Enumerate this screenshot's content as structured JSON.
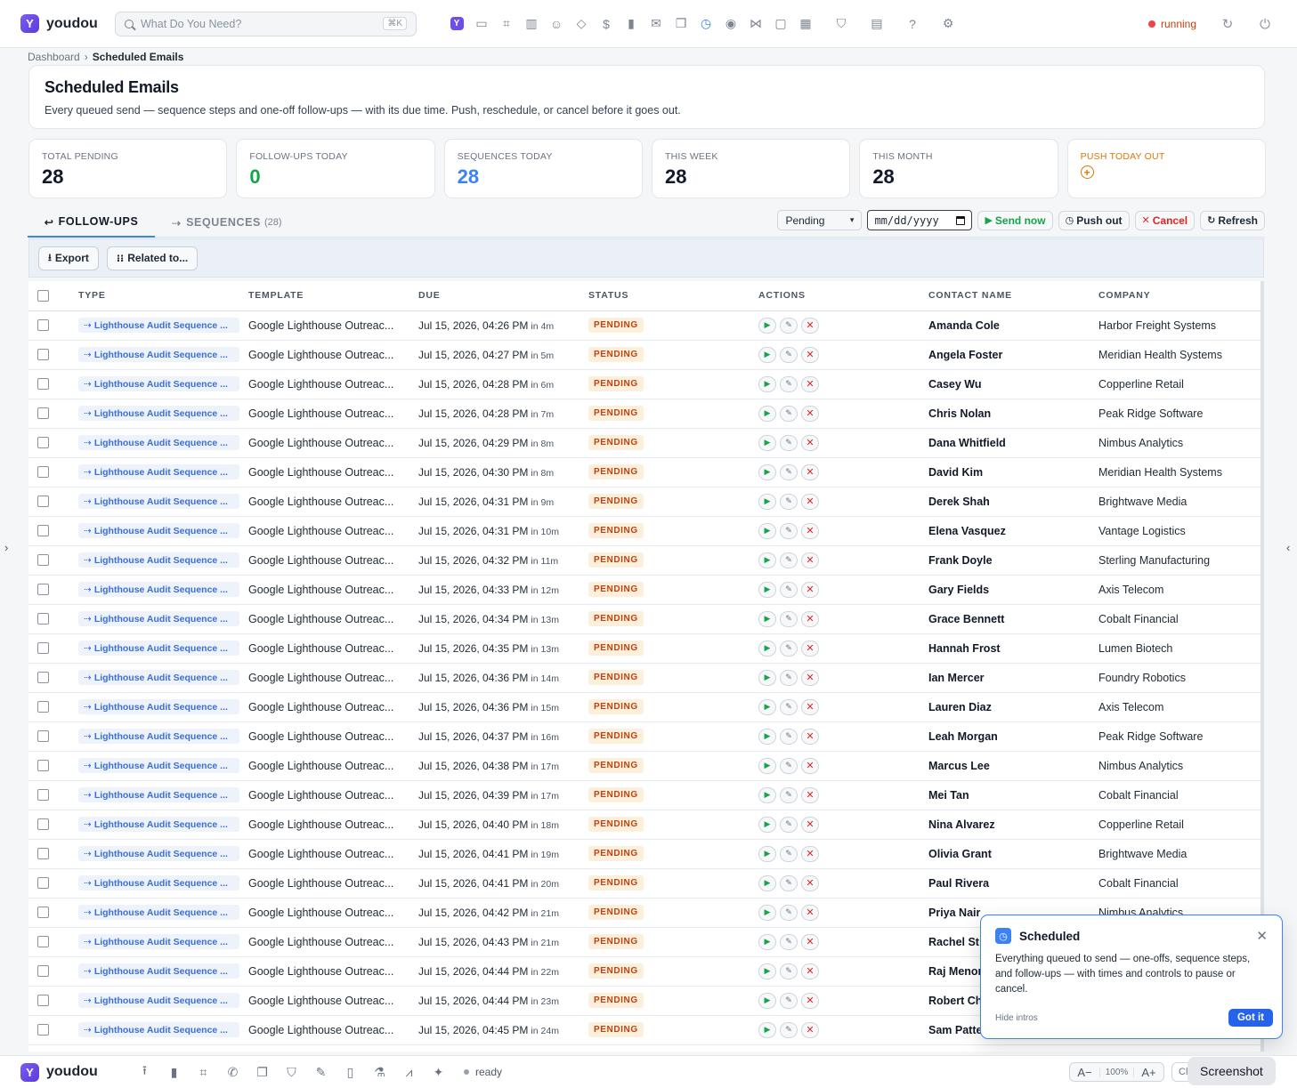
{
  "app": {
    "name": "youdou",
    "logo_letter": "Y"
  },
  "search": {
    "placeholder": "What Do You Need?",
    "shortcut": "⌘K"
  },
  "topnav": {
    "icons": [
      "ybadge-icon",
      "inbox-icon",
      "apps-grid-icon",
      "building-icon",
      "users-icon",
      "diamond-icon",
      "dollar-icon",
      "bar-chart-icon",
      "mail-icon",
      "copy-icon",
      "clock-icon",
      "eye-icon",
      "share-icon",
      "chat-icon",
      "calendar-icon",
      "shield-icon",
      "clipboard-icon",
      "help-icon",
      "gear-icon"
    ],
    "active": "clock-icon",
    "status": "running"
  },
  "breadcrumb": {
    "root": "Dashboard",
    "sep": "›",
    "current": "Scheduled Emails"
  },
  "header": {
    "title": "Scheduled Emails",
    "subtitle": "Every queued send — sequence steps and one-off follow-ups — with its due time. Push, reschedule, or cancel before it goes out."
  },
  "stats": {
    "total_pending": {
      "label": "TOTAL PENDING",
      "value": "28"
    },
    "followups_today": {
      "label": "FOLLOW-UPS TODAY",
      "value": "0"
    },
    "sequences_today": {
      "label": "SEQUENCES TODAY",
      "value": "28"
    },
    "this_week": {
      "label": "THIS WEEK",
      "value": "28"
    },
    "this_month": {
      "label": "THIS MONTH",
      "value": "28"
    },
    "push_today": {
      "label": "PUSH TODAY OUT"
    }
  },
  "tabs": {
    "followups": {
      "icon": "↩",
      "label": "FOLLOW-UPS"
    },
    "sequences": {
      "icon": "⇢",
      "label": "SEQUENCES",
      "count": "(28)"
    }
  },
  "controls": {
    "status_filter": "Pending",
    "date_placeholder": "mm/dd/yyyy",
    "send_now": "Send now",
    "push_out": "Push out",
    "cancel": "Cancel",
    "refresh": "Refresh"
  },
  "toolbar": {
    "export": "Export",
    "related": "Related to..."
  },
  "table": {
    "headers": {
      "type": "TYPE",
      "template": "TEMPLATE",
      "due": "DUE",
      "status": "STATUS",
      "actions": "ACTIONS",
      "contact": "CONTACT NAME",
      "company": "COMPANY"
    },
    "rows": [
      {
        "type": "Lighthouse Audit Sequence ...",
        "template": "Google Lighthouse Outreac...",
        "due": "Jul 15, 2026, 04:26 PM",
        "rel": "in 4m",
        "status": "PENDING",
        "contact": "Amanda Cole",
        "company": "Harbor Freight Systems"
      },
      {
        "type": "Lighthouse Audit Sequence ...",
        "template": "Google Lighthouse Outreac...",
        "due": "Jul 15, 2026, 04:27 PM",
        "rel": "in 5m",
        "status": "PENDING",
        "contact": "Angela Foster",
        "company": "Meridian Health Systems"
      },
      {
        "type": "Lighthouse Audit Sequence ...",
        "template": "Google Lighthouse Outreac...",
        "due": "Jul 15, 2026, 04:28 PM",
        "rel": "in 6m",
        "status": "PENDING",
        "contact": "Casey Wu",
        "company": "Copperline Retail"
      },
      {
        "type": "Lighthouse Audit Sequence ...",
        "template": "Google Lighthouse Outreac...",
        "due": "Jul 15, 2026, 04:28 PM",
        "rel": "in 7m",
        "status": "PENDING",
        "contact": "Chris Nolan",
        "company": "Peak Ridge Software"
      },
      {
        "type": "Lighthouse Audit Sequence ...",
        "template": "Google Lighthouse Outreac...",
        "due": "Jul 15, 2026, 04:29 PM",
        "rel": "in 8m",
        "status": "PENDING",
        "contact": "Dana Whitfield",
        "company": "Nimbus Analytics"
      },
      {
        "type": "Lighthouse Audit Sequence ...",
        "template": "Google Lighthouse Outreac...",
        "due": "Jul 15, 2026, 04:30 PM",
        "rel": "in 8m",
        "status": "PENDING",
        "contact": "David Kim",
        "company": "Meridian Health Systems"
      },
      {
        "type": "Lighthouse Audit Sequence ...",
        "template": "Google Lighthouse Outreac...",
        "due": "Jul 15, 2026, 04:31 PM",
        "rel": "in 9m",
        "status": "PENDING",
        "contact": "Derek Shah",
        "company": "Brightwave Media"
      },
      {
        "type": "Lighthouse Audit Sequence ...",
        "template": "Google Lighthouse Outreac...",
        "due": "Jul 15, 2026, 04:31 PM",
        "rel": "in 10m",
        "status": "PENDING",
        "contact": "Elena Vasquez",
        "company": "Vantage Logistics"
      },
      {
        "type": "Lighthouse Audit Sequence ...",
        "template": "Google Lighthouse Outreac...",
        "due": "Jul 15, 2026, 04:32 PM",
        "rel": "in 11m",
        "status": "PENDING",
        "contact": "Frank Doyle",
        "company": "Sterling Manufacturing"
      },
      {
        "type": "Lighthouse Audit Sequence ...",
        "template": "Google Lighthouse Outreac...",
        "due": "Jul 15, 2026, 04:33 PM",
        "rel": "in 12m",
        "status": "PENDING",
        "contact": "Gary Fields",
        "company": "Axis Telecom"
      },
      {
        "type": "Lighthouse Audit Sequence ...",
        "template": "Google Lighthouse Outreac...",
        "due": "Jul 15, 2026, 04:34 PM",
        "rel": "in 13m",
        "status": "PENDING",
        "contact": "Grace Bennett",
        "company": "Cobalt Financial"
      },
      {
        "type": "Lighthouse Audit Sequence ...",
        "template": "Google Lighthouse Outreac...",
        "due": "Jul 15, 2026, 04:35 PM",
        "rel": "in 13m",
        "status": "PENDING",
        "contact": "Hannah Frost",
        "company": "Lumen Biotech"
      },
      {
        "type": "Lighthouse Audit Sequence ...",
        "template": "Google Lighthouse Outreac...",
        "due": "Jul 15, 2026, 04:36 PM",
        "rel": "in 14m",
        "status": "PENDING",
        "contact": "Ian Mercer",
        "company": "Foundry Robotics"
      },
      {
        "type": "Lighthouse Audit Sequence ...",
        "template": "Google Lighthouse Outreac...",
        "due": "Jul 15, 2026, 04:36 PM",
        "rel": "in 15m",
        "status": "PENDING",
        "contact": "Lauren Diaz",
        "company": "Axis Telecom"
      },
      {
        "type": "Lighthouse Audit Sequence ...",
        "template": "Google Lighthouse Outreac...",
        "due": "Jul 15, 2026, 04:37 PM",
        "rel": "in 16m",
        "status": "PENDING",
        "contact": "Leah Morgan",
        "company": "Peak Ridge Software"
      },
      {
        "type": "Lighthouse Audit Sequence ...",
        "template": "Google Lighthouse Outreac...",
        "due": "Jul 15, 2026, 04:38 PM",
        "rel": "in 17m",
        "status": "PENDING",
        "contact": "Marcus Lee",
        "company": "Nimbus Analytics"
      },
      {
        "type": "Lighthouse Audit Sequence ...",
        "template": "Google Lighthouse Outreac...",
        "due": "Jul 15, 2026, 04:39 PM",
        "rel": "in 17m",
        "status": "PENDING",
        "contact": "Mei Tan",
        "company": "Cobalt Financial"
      },
      {
        "type": "Lighthouse Audit Sequence ...",
        "template": "Google Lighthouse Outreac...",
        "due": "Jul 15, 2026, 04:40 PM",
        "rel": "in 18m",
        "status": "PENDING",
        "contact": "Nina Alvarez",
        "company": "Copperline Retail"
      },
      {
        "type": "Lighthouse Audit Sequence ...",
        "template": "Google Lighthouse Outreac...",
        "due": "Jul 15, 2026, 04:41 PM",
        "rel": "in 19m",
        "status": "PENDING",
        "contact": "Olivia Grant",
        "company": "Brightwave Media"
      },
      {
        "type": "Lighthouse Audit Sequence ...",
        "template": "Google Lighthouse Outreac...",
        "due": "Jul 15, 2026, 04:41 PM",
        "rel": "in 20m",
        "status": "PENDING",
        "contact": "Paul Rivera",
        "company": "Cobalt Financial"
      },
      {
        "type": "Lighthouse Audit Sequence ...",
        "template": "Google Lighthouse Outreac...",
        "due": "Jul 15, 2026, 04:42 PM",
        "rel": "in 21m",
        "status": "PENDING",
        "contact": "Priya Nair",
        "company": "Nimbus Analytics"
      },
      {
        "type": "Lighthouse Audit Sequence ...",
        "template": "Google Lighthouse Outreac...",
        "due": "Jul 15, 2026, 04:43 PM",
        "rel": "in 21m",
        "status": "PENDING",
        "contact": "Rachel St",
        "company": ""
      },
      {
        "type": "Lighthouse Audit Sequence ...",
        "template": "Google Lighthouse Outreac...",
        "due": "Jul 15, 2026, 04:44 PM",
        "rel": "in 22m",
        "status": "PENDING",
        "contact": "Raj Menon",
        "company": ""
      },
      {
        "type": "Lighthouse Audit Sequence ...",
        "template": "Google Lighthouse Outreac...",
        "due": "Jul 15, 2026, 04:44 PM",
        "rel": "in 23m",
        "status": "PENDING",
        "contact": "Robert Ch",
        "company": ""
      },
      {
        "type": "Lighthouse Audit Sequence ...",
        "template": "Google Lighthouse Outreac...",
        "due": "Jul 15, 2026, 04:45 PM",
        "rel": "in 24m",
        "status": "PENDING",
        "contact": "Sam Patte",
        "company": ""
      }
    ]
  },
  "popover": {
    "title": "Scheduled",
    "body": "Everything queued to send — one-offs, sequence steps, and follow-ups — with times and controls to pause or cancel.",
    "hide": "Hide intros",
    "button": "Got it"
  },
  "bottombar": {
    "icons": [
      "upload-icon",
      "bar-chart-icon",
      "apps-grid-icon",
      "phone-icon",
      "copy-icon",
      "shield-icon",
      "pen-icon",
      "file-icon",
      "flask-icon",
      "line-chart-icon",
      "sparkle-icon"
    ],
    "status": "ready",
    "zoom_out": "A−",
    "zoom_value": "100%",
    "zoom_in": "A+",
    "clear": "Cl",
    "screenshot": "Screenshot"
  },
  "colors": {
    "accent": "#3b82f6",
    "brand": "#6d4ee8",
    "pending_bg": "#fcefdc",
    "pending_fg": "#c2410c",
    "success": "#16a34a",
    "danger": "#dc2626"
  }
}
